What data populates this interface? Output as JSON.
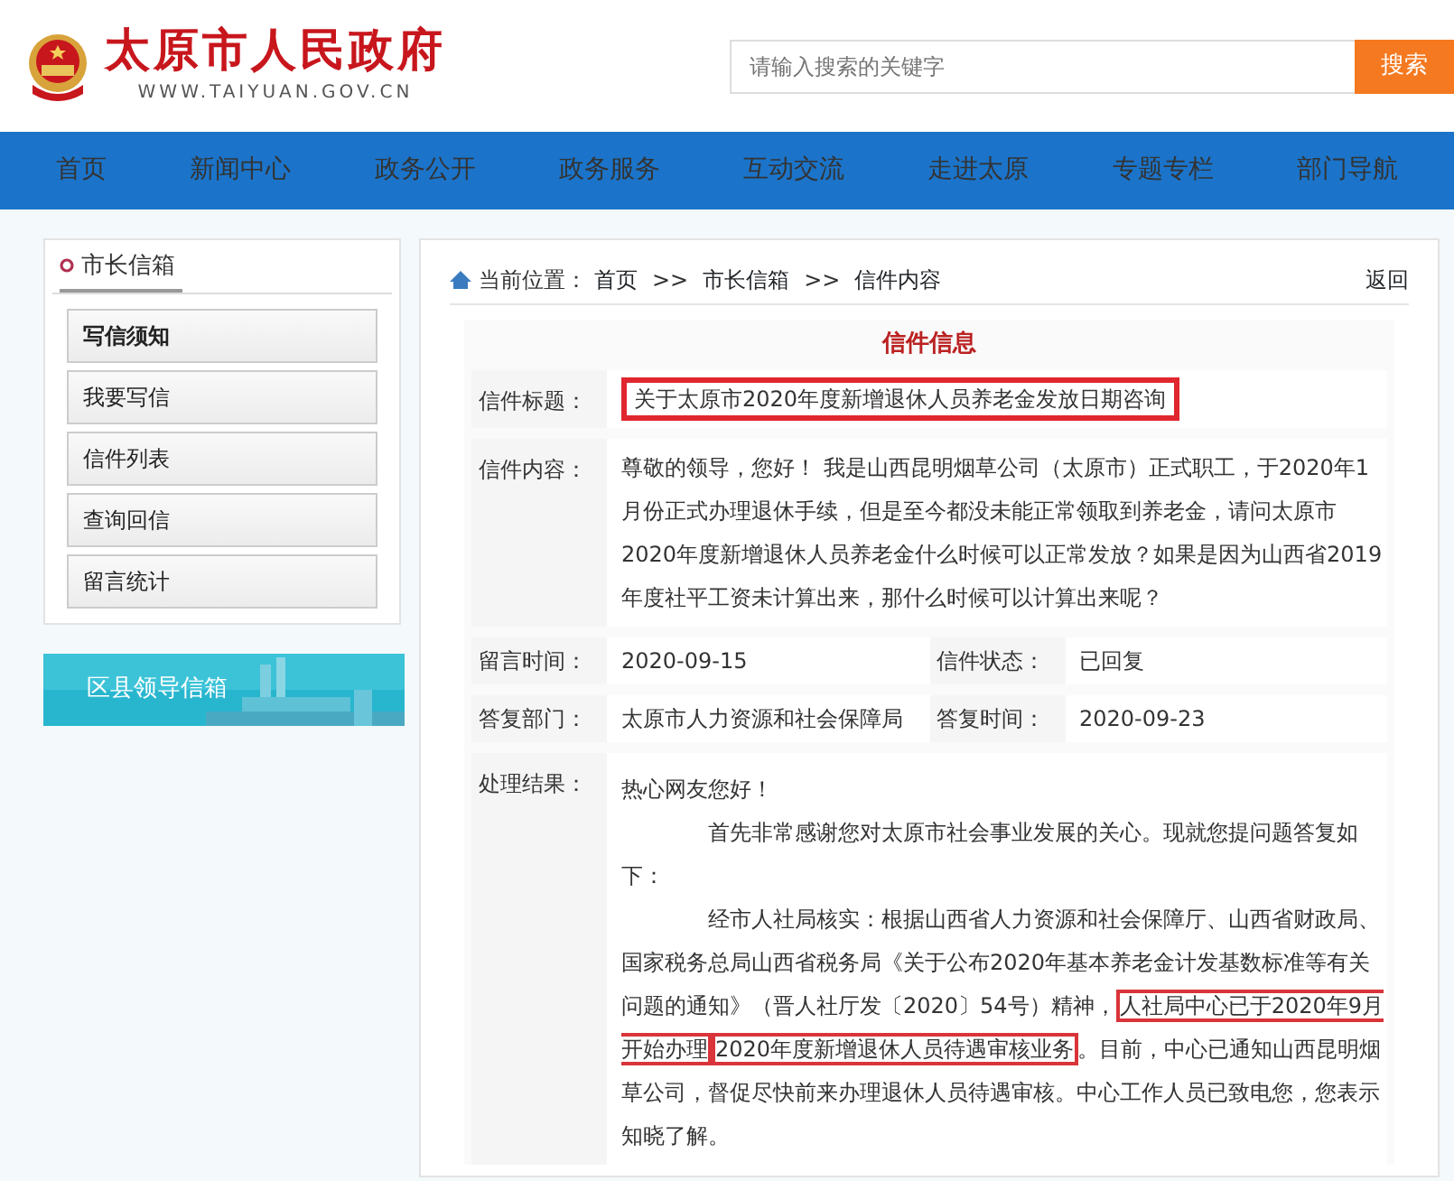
{
  "header": {
    "site_title": "太原市人民政府",
    "site_url": "WWW.TAIYUAN.GOV.CN",
    "search": {
      "placeholder": "请输入搜索的关键字",
      "button": "搜索"
    }
  },
  "nav": [
    "首页",
    "新闻中心",
    "政务公开",
    "政务服务",
    "互动交流",
    "走进太原",
    "专题专栏",
    "部门导航"
  ],
  "sidebar": {
    "title": "市长信箱",
    "items": [
      "写信须知",
      "我要写信",
      "信件列表",
      "查询回信",
      "留言统计"
    ],
    "banner": {
      "label": "区县领导信箱",
      "kind": "picture"
    }
  },
  "breadcrumb": {
    "label": "当前位置：",
    "path": [
      "首页",
      "市长信箱",
      "信件内容"
    ],
    "separator": ">>",
    "back": "返回"
  },
  "letter": {
    "heading": "信件信息",
    "title": {
      "label": "信件标题：",
      "value": "关于太原市2020年度新增退休人员养老金发放日期咨询",
      "highlighted": true
    },
    "content": {
      "label": "信件内容：",
      "value": "尊敬的领导，您好！ 我是山西昆明烟草公司（太原市）正式职工，于2020年1月份正式办理退休手续，但是至今都没未能正常领取到养老金，请问太原市2020年度新增退休人员养老金什么时候可以正常发放？如果是因为山西省2019年度社平工资未计算出来，那什么时候可以计算出来呢？"
    },
    "meta": [
      [
        {
          "label": "留言时间：",
          "value": "2020-09-15"
        },
        {
          "label": "信件状态：",
          "value": "已回复"
        }
      ],
      [
        {
          "label": "答复部门：",
          "value": "太原市人力资源和社会保障局"
        },
        {
          "label": "答复时间：",
          "value": "2020-09-23"
        }
      ]
    ],
    "result": {
      "label": "处理结果：",
      "paragraphs": [
        {
          "indent": false,
          "segments": [
            {
              "text": "热心网友您好！",
              "highlighted": false
            }
          ]
        },
        {
          "indent": true,
          "segments": [
            {
              "text": "首先非常感谢您对太原市社会事业发展的关心。现就您提问题答复如下：",
              "highlighted": false
            }
          ]
        },
        {
          "indent": true,
          "segments": [
            {
              "text": "经市人社局核实：根据山西省人力资源和社会保障厅、山西省财政局、国家税务总局山西省税务局《关于公布2020年基本养老金计发基数标准等有关问题的通知》（晋人社厅发〔2020〕54号）精神，",
              "highlighted": false
            },
            {
              "text": "人社局中心已于2020年9月开始办理",
              "highlighted": true
            },
            {
              "text": "2020年度新增退休人员待遇审核业务",
              "highlighted": true
            },
            {
              "text": "。目前，中心已通知山西昆明烟草公司，督促尽快前来办理退休人员待遇审核。中心工作人员已致电您，您表示知晓了解。",
              "highlighted": false
            }
          ]
        }
      ]
    }
  }
}
